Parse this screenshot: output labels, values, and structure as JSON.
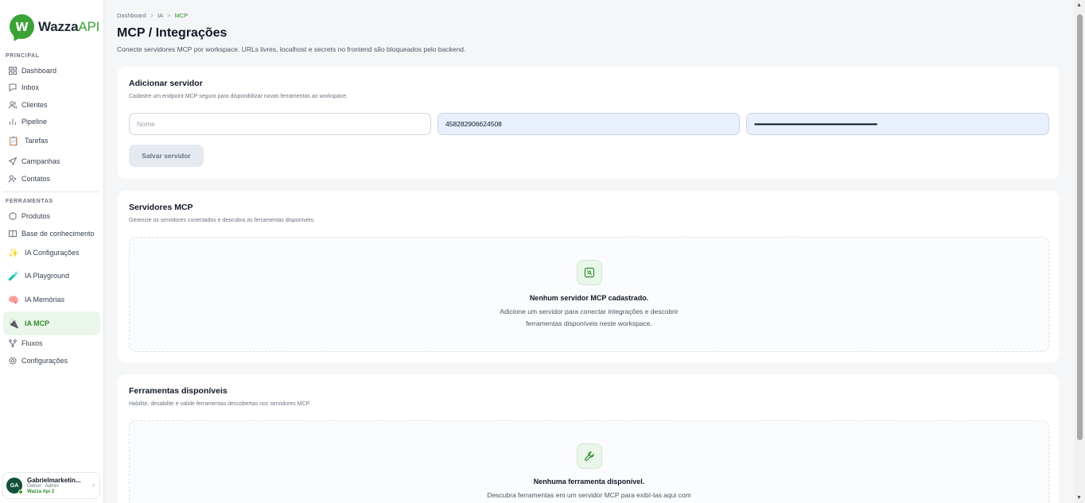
{
  "brand": {
    "name": "Wazza",
    "name_suffix": "API",
    "mark": "W"
  },
  "sidebar": {
    "section_principal": "PRINCIPAL",
    "section_ferramentas": "FERRAMENTAS",
    "principal": [
      {
        "label": "Dashboard",
        "icon": "grid-icon"
      },
      {
        "label": "Inbox",
        "icon": "message-icon"
      },
      {
        "label": "Clientes",
        "icon": "users-icon"
      },
      {
        "label": "Pipeline",
        "icon": "bar-chart-icon"
      },
      {
        "label": "Tarefas",
        "icon": "clipboard-icon"
      },
      {
        "label": "Campanhas",
        "icon": "send-icon"
      },
      {
        "label": "Contatos",
        "icon": "user-plus-icon"
      }
    ],
    "ferramentas": [
      {
        "label": "Produtos",
        "icon": "box-icon"
      },
      {
        "label": "Base de conhecimento",
        "icon": "book-icon"
      },
      {
        "label": "IA Configurações",
        "icon": "sparkles-icon"
      },
      {
        "label": "IA Playground",
        "icon": "test-tube-icon"
      },
      {
        "label": "IA Memórias",
        "icon": "brain-icon"
      },
      {
        "label": "IA MCP",
        "icon": "plug-icon"
      },
      {
        "label": "Fluxos",
        "icon": "flow-icon"
      },
      {
        "label": "Configurações",
        "icon": "gear-icon"
      }
    ],
    "user": {
      "initials": "GA",
      "name": "Gabrielmarketin...",
      "role": "Owner · Admin",
      "workspace": "Wazza Api 2"
    }
  },
  "breadcrumb": {
    "items": [
      "Dashboard",
      "IA",
      "MCP"
    ],
    "separator": ">"
  },
  "page": {
    "title": "MCP / Integrações",
    "subtitle": "Conecte servidores MCP por workspace. URLs livres, localhost e secrets no frontend são bloqueados pelo backend."
  },
  "add_server": {
    "title": "Adicionar servidor",
    "subtitle": "Cadastre um endpoint MCP seguro para disponibilizar novas ferramentas ao workspace.",
    "name_placeholder": "Nome",
    "url_value": "458282906624508",
    "secret_value": "••••••••••••••••••••••••••••••••••••••••••••••••••••••••••••••••••••••••••••••••••••••••••••••••••••••••••••••••••••••••••••••••",
    "save_label": "Salvar servidor"
  },
  "servers": {
    "title": "Servidores MCP",
    "subtitle": "Gerencie os servidores conectados e descubra as ferramentas disponíveis.",
    "empty_title": "Nenhum servidor MCP cadastrado.",
    "empty_line1": "Adicione um servidor para conectar integrações e descobrir",
    "empty_line2": "ferramentas disponíveis neste workspace."
  },
  "tools": {
    "title": "Ferramentas disponíveis",
    "subtitle": "Habilite, desabilite e valide ferramentas descobertas nos servidores MCP.",
    "empty_title": "Nenhuma ferramenta disponível.",
    "empty_line1": "Descubra ferramentas em um servidor MCP para exibí-las aqui com"
  },
  "colors": {
    "accent": "#3aa336",
    "active_bg": "#eaf6ea",
    "input_filled": "#e8f0fe"
  }
}
